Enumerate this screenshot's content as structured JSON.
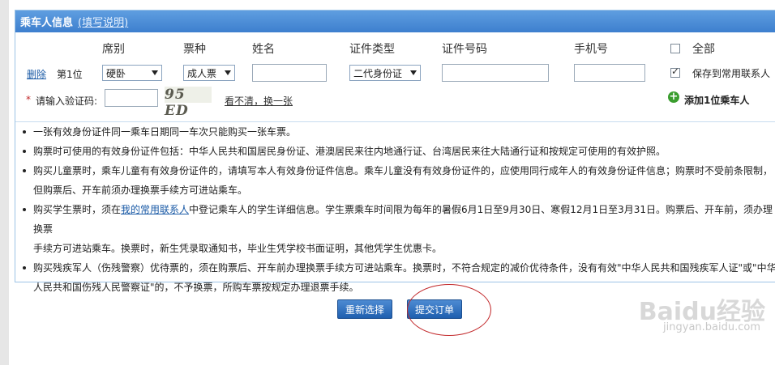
{
  "panel": {
    "title": "乘车人信息",
    "help_link": "(填写说明)"
  },
  "columns": {
    "seat": "席别",
    "ticket_type": "票种",
    "name": "姓名",
    "id_type": "证件类型",
    "id_number": "证件号码",
    "phone": "手机号",
    "all": "全部"
  },
  "passenger": {
    "delete_link": "删除",
    "seq": "第1位",
    "seat_value": "硬卧",
    "ticket_value": "成人票",
    "id_type_value": "二代身份证",
    "save_contact_label": "保存到常用联系人",
    "save_checked": true
  },
  "captcha": {
    "star": "*",
    "label": "请输入验证码:",
    "image_text": "95 ED",
    "refresh_link": "看不清，换一张"
  },
  "add_passenger": "添加1位乘车人",
  "notes": [
    {
      "lines": [
        "一张有效身份证件同一乘车日期同一车次只能购买一张车票。"
      ]
    },
    {
      "lines": [
        "购票时可使用的有效身份证件包括：中华人民共和国居民身份证、港澳居民来往内地通行证、台湾居民来往大陆通行证和按规定可使用的有效护照。"
      ]
    },
    {
      "lines": [
        "购买儿童票时，乘车儿童有有效身份证件的，请填写本人有效身份证件信息。乘车儿童没有有效身份证件的，应使用同行成年人的有效身份证件信息；购票时不受前条限制，",
        "但购票后、开车前须办理换票手续方可进站乘车。"
      ]
    },
    {
      "pre": "购买学生票时，须在",
      "link": "我的常用联系人",
      "post": "中登记乘车人的学生详细信息。学生票乘车时间限为每年的暑假6月1日至9月30日、寒假12月1日至3月31日。购票后、开车前，须办理换票",
      "lines": [
        "手续方可进站乘车。换票时，新生凭录取通知书，毕业生凭学校书面证明，其他凭学生优惠卡。"
      ]
    },
    {
      "lines": [
        "购买残疾军人（伤残警察）优待票的，须在购票后、开车前办理换票手续方可进站乘车。换票时，不符合规定的减价优待条件，没有有效\"中华人民共和国残疾军人证\"或\"中华",
        "人民共和国伤残人民警察证\"的，不予换票，所购车票按规定办理退票手续。"
      ]
    }
  ],
  "buttons": {
    "reset": "重新选择",
    "submit": "提交订单"
  },
  "watermark": {
    "brand": "Baidu经验",
    "url": "jingyan.baidu.com"
  }
}
